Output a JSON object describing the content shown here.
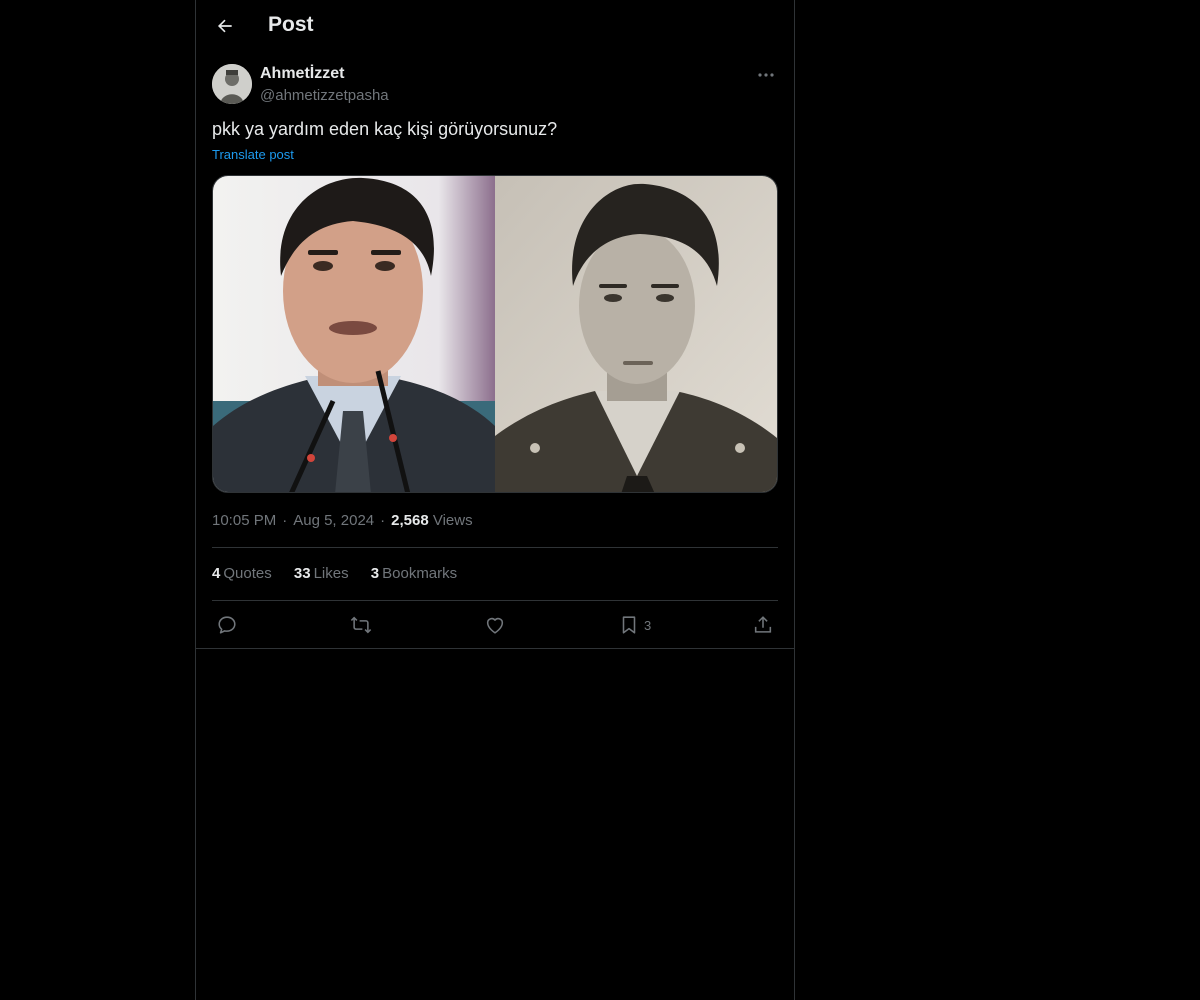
{
  "header": {
    "title": "Post"
  },
  "author": {
    "display_name": "Ahmetİzzet",
    "handle": "@ahmetizzetpasha"
  },
  "post": {
    "text": "pkk ya yardım eden kaç kişi görüyorsunuz?",
    "translate_label": "Translate post",
    "time": "10:05 PM",
    "date": "Aug 5, 2024",
    "views_count": "2,568",
    "views_label": "Views"
  },
  "stats": {
    "quotes_count": "4",
    "quotes_label": "Quotes",
    "likes_count": "33",
    "likes_label": "Likes",
    "bookmarks_count": "3",
    "bookmarks_label": "Bookmarks"
  },
  "actions": {
    "bookmark_count": "3"
  },
  "icons": {
    "back": "arrow-left-icon",
    "more": "more-horizontal-icon",
    "reply": "reply-icon",
    "repost": "repost-icon",
    "like": "heart-icon",
    "bookmark": "bookmark-icon",
    "share": "share-icon"
  },
  "colors": {
    "background": "#000000",
    "text": "#e7e9ea",
    "muted": "#71767b",
    "link": "#1d9bf0",
    "border": "#2f3336"
  }
}
